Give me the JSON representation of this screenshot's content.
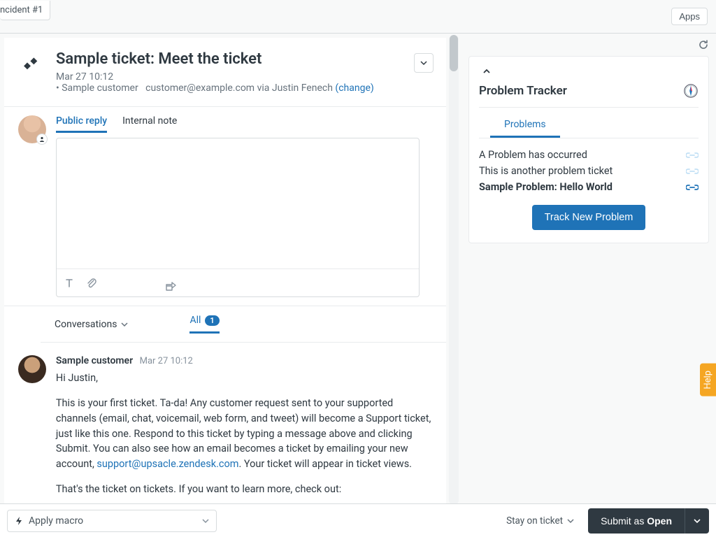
{
  "topbar": {
    "tab_label": "ncident #1",
    "apps_label": "Apps"
  },
  "ticket": {
    "title": "Sample ticket: Meet the ticket",
    "timestamp": "Mar 27 10:12",
    "requester_prefix": "• Sample customer",
    "requester_email": "customer@example.com",
    "via": "via Justin Fenech",
    "change_label": "(change)"
  },
  "reply": {
    "tabs": {
      "public": "Public reply",
      "internal": "Internal note"
    }
  },
  "conversations": {
    "label": "Conversations",
    "filter_all": "All",
    "count": "1"
  },
  "message": {
    "author": "Sample customer",
    "time": "Mar 27 10:12",
    "greeting": "Hi Justin,",
    "p1a": "This is your first ticket. Ta-da! Any customer request sent to your supported channels (email, chat, voicemail, web form, and tweet) will become a Support ticket, just like this one. Respond to this ticket by typing a message above and clicking Submit. You can also see how an email becomes a ticket by emailing your new account, ",
    "email": "support@upsacle.zendesk.com",
    "p1b": ". Your ticket will appear in ticket views.",
    "p2": "That's the ticket on tickets. If you want to learn more, check out:"
  },
  "sidebar": {
    "title": "Problem Tracker",
    "tab": "Problems",
    "items": [
      {
        "label": "A Problem has occurred",
        "active": false
      },
      {
        "label": "This is another problem ticket",
        "active": false
      },
      {
        "label": "Sample Problem: Hello World",
        "active": true
      }
    ],
    "button": "Track New Problem"
  },
  "footer": {
    "macro": "Apply macro",
    "stay": "Stay on ticket",
    "submit_prefix": "Submit as ",
    "submit_state": "Open"
  },
  "help": "Help"
}
